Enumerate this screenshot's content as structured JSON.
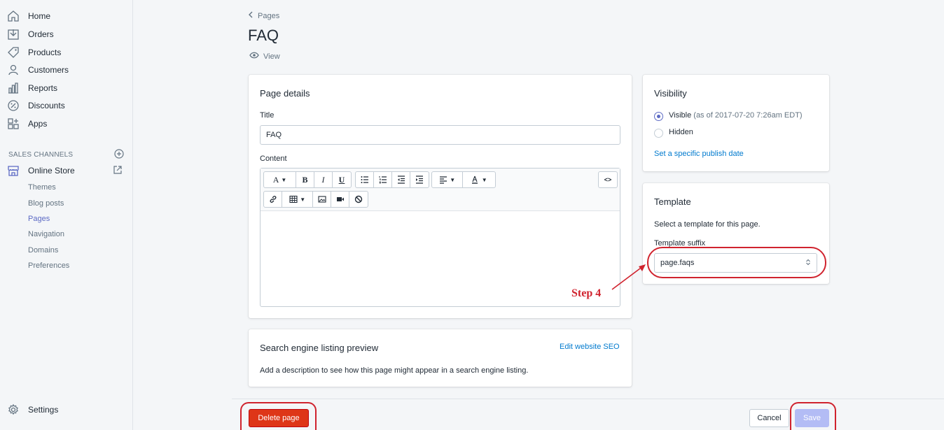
{
  "sidebar": {
    "items": [
      {
        "label": "Home",
        "icon": "home-icon"
      },
      {
        "label": "Orders",
        "icon": "orders-icon"
      },
      {
        "label": "Products",
        "icon": "tag-icon"
      },
      {
        "label": "Customers",
        "icon": "user-icon"
      },
      {
        "label": "Reports",
        "icon": "bar-chart-icon"
      },
      {
        "label": "Discounts",
        "icon": "discount-icon"
      },
      {
        "label": "Apps",
        "icon": "apps-icon"
      }
    ],
    "sales_channels_heading": "SALES CHANNELS",
    "online_store": "Online Store",
    "sub_items": [
      "Themes",
      "Blog posts",
      "Pages",
      "Navigation",
      "Domains",
      "Preferences"
    ],
    "active_sub_item": "Pages",
    "settings": "Settings"
  },
  "header": {
    "breadcrumb": "Pages",
    "title": "FAQ",
    "view_label": "View"
  },
  "page_details": {
    "heading": "Page details",
    "title_label": "Title",
    "title_value": "FAQ",
    "content_label": "Content",
    "toolbar_row1": [
      "A",
      "B",
      "I",
      "U",
      "bulleted-list",
      "numbered-list",
      "outdent",
      "indent",
      "align",
      "text-color"
    ],
    "toolbar_row2": [
      "link",
      "table",
      "image",
      "video",
      "clear-formatting"
    ],
    "html_toggle": "<>"
  },
  "seo": {
    "heading": "Search engine listing preview",
    "edit_link": "Edit website SEO",
    "description": "Add a description to see how this page might appear in a search engine listing."
  },
  "visibility": {
    "heading": "Visibility",
    "visible_label": "Visible",
    "visible_note": "(as of 2017-07-20 7:26am EDT)",
    "hidden_label": "Hidden",
    "selected": "Visible",
    "publish_link": "Set a specific publish date"
  },
  "template": {
    "heading": "Template",
    "description": "Select a template for this page.",
    "suffix_label": "Template suffix",
    "suffix_value": "page.faqs"
  },
  "annotation": {
    "step_label": "Step 4",
    "color": "#d0232e"
  },
  "footer": {
    "delete_label": "Delete page",
    "cancel_label": "Cancel",
    "save_label": "Save"
  },
  "colors": {
    "accent": "#5c6ac4",
    "link": "#007ace",
    "danger": "#de3618",
    "save_disabled": "#b3bcf5"
  }
}
